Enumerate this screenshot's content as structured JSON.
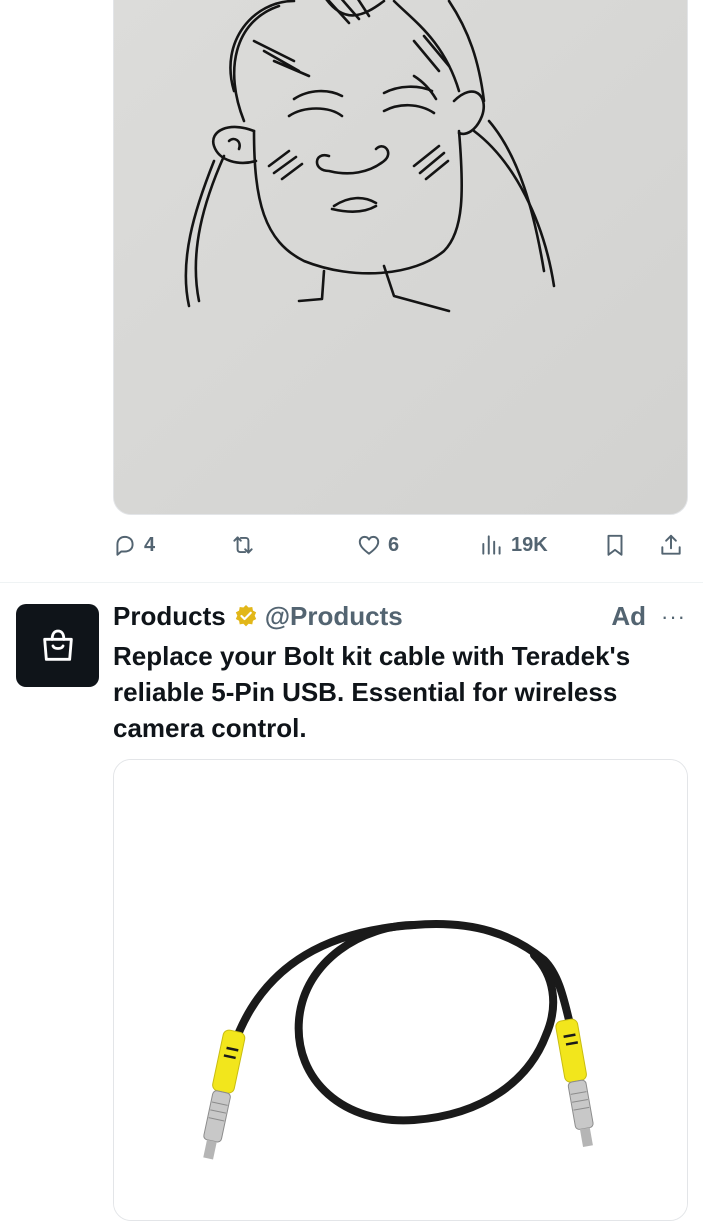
{
  "tweet_top": {
    "media_icon": "ink-drawing-of-face",
    "actions": {
      "reply": {
        "icon": "reply-icon",
        "count": "4"
      },
      "retweet": {
        "icon": "retweet-icon",
        "count": ""
      },
      "like": {
        "icon": "heart-icon",
        "count": "6"
      },
      "views": {
        "icon": "views-icon",
        "count": "19K"
      },
      "bookmark": {
        "icon": "bookmark-icon"
      },
      "share": {
        "icon": "share-icon"
      }
    }
  },
  "ad_tweet": {
    "avatar_icon": "shopping-bag-icon",
    "name": "Products",
    "verified_icon": "verified-gold-badge-icon",
    "handle": "@Products",
    "ad_label": "Ad",
    "more_icon": "more-icon",
    "more_glyph": "···",
    "text": "Replace your Bolt kit cable with Teradek's reliable 5-Pin USB. Essential for wireless camera control.",
    "media_icon": "cable-product-image"
  },
  "colors": {
    "text_primary": "#0f1419",
    "text_secondary": "#536471",
    "badge_gold": "#e2b719",
    "cable_black": "#1a1a1a",
    "connector_yellow": "#f2e61c"
  }
}
